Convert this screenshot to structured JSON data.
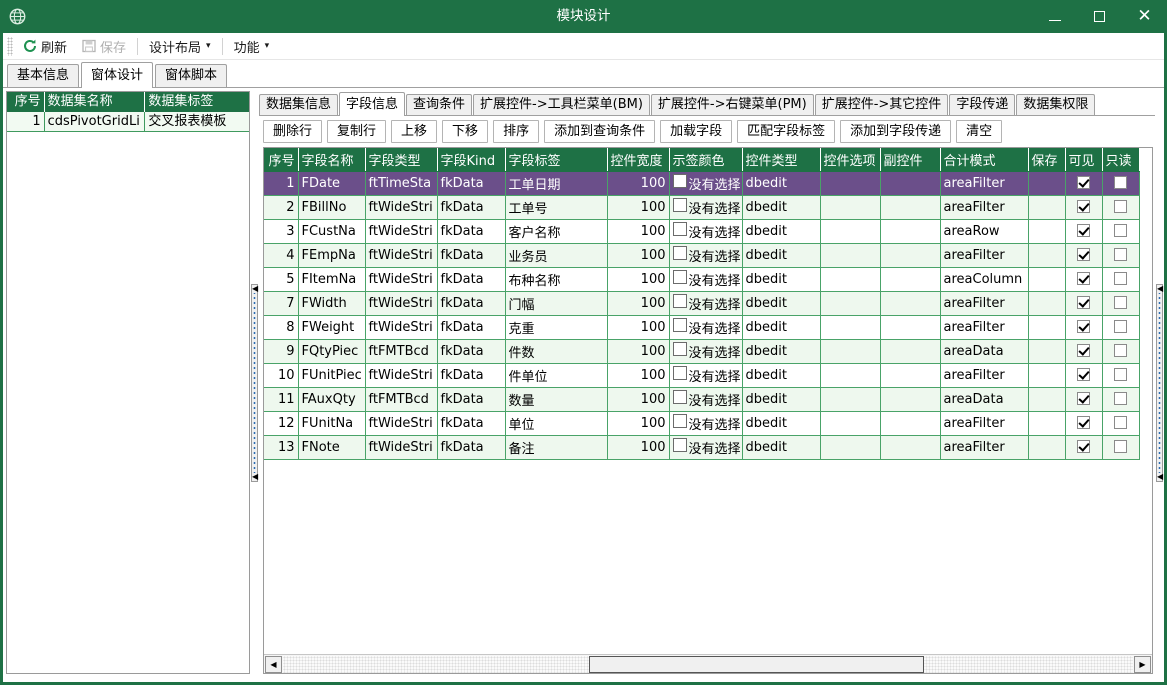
{
  "window": {
    "title": "模块设计",
    "app_icon": "globe-icon",
    "minimize_label": "–",
    "maximize_label": "□",
    "close_label": "✕",
    "accent_color": "#1e7145",
    "selection_color": "#6b4f8a",
    "grid_line_color": "#49a368"
  },
  "toolbar": {
    "refresh_label": "刷新",
    "save_label": "保存",
    "layout_label": "设计布局",
    "function_label": "功能",
    "caret": "▾"
  },
  "main_tabs": [
    {
      "label": "基本信息",
      "active": false
    },
    {
      "label": "窗体设计",
      "active": true
    },
    {
      "label": "窗体脚本",
      "active": false
    }
  ],
  "dataset_panel": {
    "headers": [
      "序号",
      "数据集名称",
      "数据集标签"
    ],
    "rows": [
      {
        "seq": "1",
        "name": "cdsPivotGridLi",
        "label": "交叉报表模板"
      }
    ]
  },
  "sub_tabs": [
    {
      "label": "数据集信息",
      "active": false
    },
    {
      "label": "字段信息",
      "active": true
    },
    {
      "label": "查询条件",
      "active": false
    },
    {
      "label": "扩展控件->工具栏菜单(BM)",
      "active": false
    },
    {
      "label": "扩展控件->右键菜单(PM)",
      "active": false
    },
    {
      "label": "扩展控件->其它控件",
      "active": false
    },
    {
      "label": "字段传递",
      "active": false
    },
    {
      "label": "数据集权限",
      "active": false
    }
  ],
  "action_buttons": [
    "删除行",
    "复制行",
    "上移",
    "下移",
    "排序",
    "添加到查询条件",
    "加载字段",
    "匹配字段标签",
    "添加到字段传递",
    "清空"
  ],
  "field_grid": {
    "headers": [
      "序号",
      "字段名称",
      "字段类型",
      "字段Kind",
      "字段标签",
      "控件宽度",
      "示签颜色",
      "控件类型",
      "控件选项",
      "副控件",
      "合计模式",
      "保存",
      "可见",
      "只读"
    ],
    "color_cell_text": "没有选择",
    "rows": [
      {
        "seq": "1",
        "name": "FDate",
        "type": "ftTimeSta",
        "kind": "fkData",
        "label": "工单日期",
        "width": "100",
        "control": "dbedit",
        "option": "",
        "sub": "",
        "total": "areaFilter",
        "save": "",
        "visible": true,
        "readonly": false,
        "selected": true
      },
      {
        "seq": "2",
        "name": "FBillNo",
        "type": "ftWideStri",
        "kind": "fkData",
        "label": "工单号",
        "width": "100",
        "control": "dbedit",
        "option": "",
        "sub": "",
        "total": "areaFilter",
        "save": "",
        "visible": true,
        "readonly": false,
        "selected": false
      },
      {
        "seq": "3",
        "name": "FCustNa",
        "type": "ftWideStri",
        "kind": "fkData",
        "label": "客户名称",
        "width": "100",
        "control": "dbedit",
        "option": "",
        "sub": "",
        "total": "areaRow",
        "save": "",
        "visible": true,
        "readonly": false,
        "selected": false
      },
      {
        "seq": "4",
        "name": "FEmpNa",
        "type": "ftWideStri",
        "kind": "fkData",
        "label": "业务员",
        "width": "100",
        "control": "dbedit",
        "option": "",
        "sub": "",
        "total": "areaFilter",
        "save": "",
        "visible": true,
        "readonly": false,
        "selected": false
      },
      {
        "seq": "5",
        "name": "FItemNa",
        "type": "ftWideStri",
        "kind": "fkData",
        "label": "布种名称",
        "width": "100",
        "control": "dbedit",
        "option": "",
        "sub": "",
        "total": "areaColumn",
        "save": "",
        "visible": true,
        "readonly": false,
        "selected": false
      },
      {
        "seq": "7",
        "name": "FWidth",
        "type": "ftWideStri",
        "kind": "fkData",
        "label": "门幅",
        "width": "100",
        "control": "dbedit",
        "option": "",
        "sub": "",
        "total": "areaFilter",
        "save": "",
        "visible": true,
        "readonly": false,
        "selected": false
      },
      {
        "seq": "8",
        "name": "FWeight",
        "type": "ftWideStri",
        "kind": "fkData",
        "label": "克重",
        "width": "100",
        "control": "dbedit",
        "option": "",
        "sub": "",
        "total": "areaFilter",
        "save": "",
        "visible": true,
        "readonly": false,
        "selected": false
      },
      {
        "seq": "9",
        "name": "FQtyPiec",
        "type": "ftFMTBcd",
        "kind": "fkData",
        "label": "件数",
        "width": "100",
        "control": "dbedit",
        "option": "",
        "sub": "",
        "total": "areaData",
        "save": "",
        "visible": true,
        "readonly": false,
        "selected": false
      },
      {
        "seq": "10",
        "name": "FUnitPiec",
        "type": "ftWideStri",
        "kind": "fkData",
        "label": "件单位",
        "width": "100",
        "control": "dbedit",
        "option": "",
        "sub": "",
        "total": "areaFilter",
        "save": "",
        "visible": true,
        "readonly": false,
        "selected": false
      },
      {
        "seq": "11",
        "name": "FAuxQty",
        "type": "ftFMTBcd",
        "kind": "fkData",
        "label": "数量",
        "width": "100",
        "control": "dbedit",
        "option": "",
        "sub": "",
        "total": "areaData",
        "save": "",
        "visible": true,
        "readonly": false,
        "selected": false
      },
      {
        "seq": "12",
        "name": "FUnitNa",
        "type": "ftWideStri",
        "kind": "fkData",
        "label": "单位",
        "width": "100",
        "control": "dbedit",
        "option": "",
        "sub": "",
        "total": "areaFilter",
        "save": "",
        "visible": true,
        "readonly": false,
        "selected": false
      },
      {
        "seq": "13",
        "name": "FNote",
        "type": "ftWideStri",
        "kind": "fkData",
        "label": "备注",
        "width": "100",
        "control": "dbedit",
        "option": "",
        "sub": "",
        "total": "areaFilter",
        "save": "",
        "visible": true,
        "readonly": false,
        "selected": false
      }
    ]
  },
  "scrollbar": {
    "left_arrow": "◀",
    "right_arrow": "▶"
  }
}
